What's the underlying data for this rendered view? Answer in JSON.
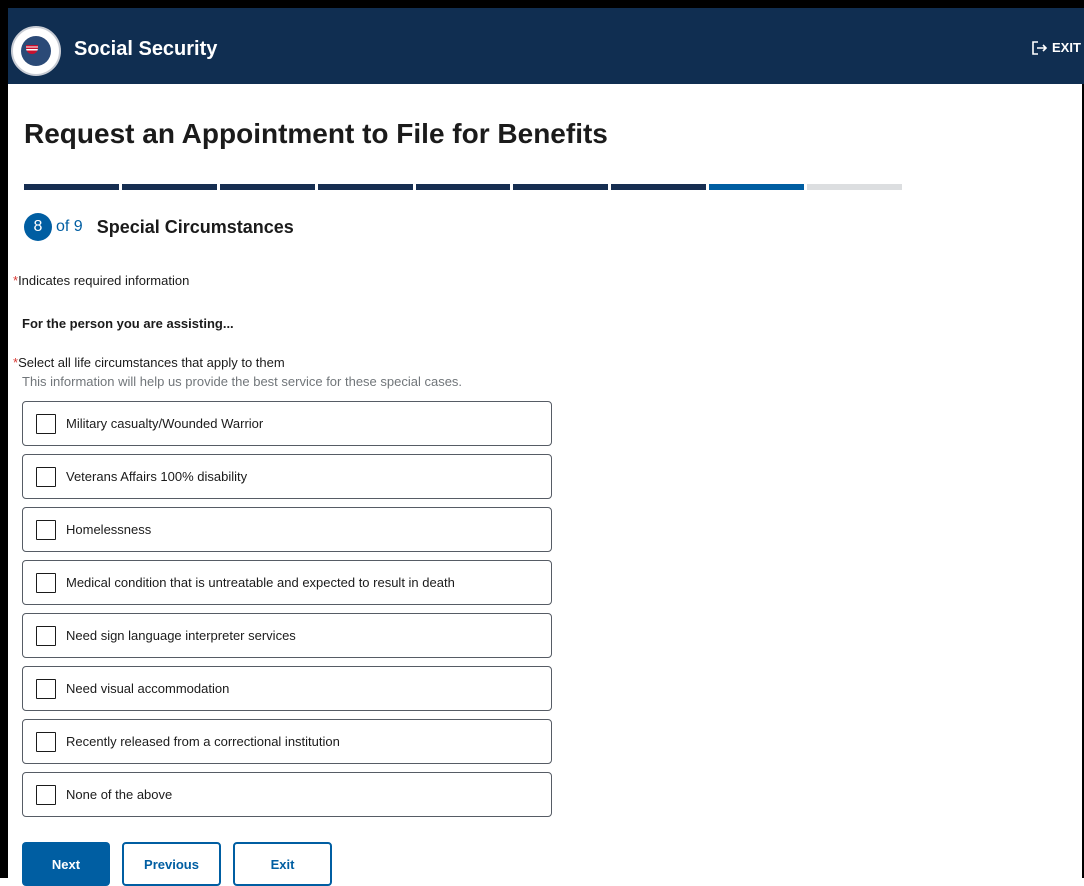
{
  "header": {
    "title": "Social Security",
    "exit_label": "EXIT"
  },
  "page": {
    "title": "Request an Appointment to File for Benefits"
  },
  "progress": {
    "total_steps": 9,
    "current_step": 8
  },
  "step": {
    "number": "8",
    "of_text": "of 9",
    "title": "Special Circumstances"
  },
  "form": {
    "required_marker": "*",
    "required_note": "Indicates required information",
    "assisting_label": "For the person you are assisting...",
    "question": "Select all life circumstances that apply to them",
    "hint": "This information will help us provide the best service for these special cases.",
    "options": [
      {
        "label": "Military casualty/Wounded Warrior",
        "checked": false
      },
      {
        "label": "Veterans Affairs 100% disability",
        "checked": false
      },
      {
        "label": "Homelessness",
        "checked": false
      },
      {
        "label": "Medical condition that is untreatable and expected to result in death",
        "checked": false
      },
      {
        "label": "Need sign language interpreter services",
        "checked": false
      },
      {
        "label": "Need visual accommodation",
        "checked": false
      },
      {
        "label": "Recently released from a correctional institution",
        "checked": false
      },
      {
        "label": "None of the above",
        "checked": false
      }
    ]
  },
  "buttons": {
    "next": "Next",
    "previous": "Previous",
    "exit": "Exit"
  },
  "colors": {
    "header_bg": "#102e51",
    "primary": "#005ea2",
    "progress_done": "#162e51",
    "required": "#d83933"
  },
  "icons": {
    "logo": "ssa-seal-icon",
    "exit": "exit-icon"
  }
}
